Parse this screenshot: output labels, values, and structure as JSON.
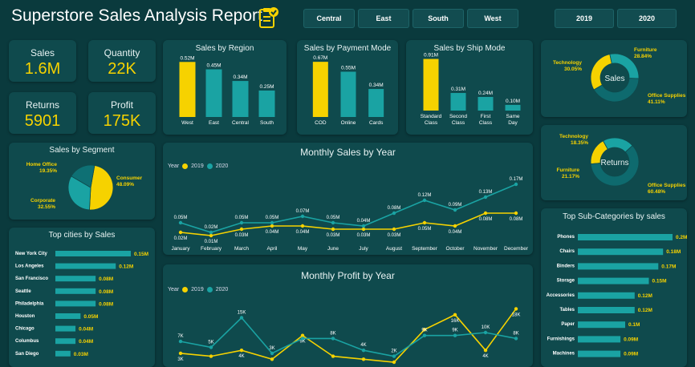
{
  "header": {
    "title": "Superstore Sales Analysis Report",
    "regions": [
      "Central",
      "East",
      "South",
      "West"
    ],
    "years": [
      "2019",
      "2020"
    ]
  },
  "colors": {
    "yellow": "#f6d200",
    "teal": "#1aa3a3",
    "bg": "#0a3a3d",
    "card": "#0f4a4d"
  },
  "kpis": {
    "sales": {
      "label": "Sales",
      "value": "1.6M"
    },
    "quantity": {
      "label": "Quantity",
      "value": "22K"
    },
    "returns": {
      "label": "Returns",
      "value": "5901"
    },
    "profit": {
      "label": "Profit",
      "value": "175K"
    }
  },
  "chart_data": [
    {
      "id": "region",
      "type": "bar",
      "title": "Sales by Region",
      "categories": [
        "West",
        "East",
        "Central",
        "South"
      ],
      "values": [
        0.52,
        0.45,
        0.34,
        0.25
      ],
      "labels": [
        "0.52M",
        "0.45M",
        "0.34M",
        "0.25M"
      ],
      "colors": [
        "#f6d200",
        "#1aa3a3",
        "#1aa3a3",
        "#1aa3a3"
      ]
    },
    {
      "id": "payment",
      "type": "bar",
      "title": "Sales by Payment Mode",
      "categories": [
        "COD",
        "Online",
        "Cards"
      ],
      "values": [
        0.67,
        0.55,
        0.34
      ],
      "labels": [
        "0.67M",
        "0.55M",
        "0.34M"
      ],
      "colors": [
        "#f6d200",
        "#1aa3a3",
        "#1aa3a3"
      ]
    },
    {
      "id": "ship",
      "type": "bar",
      "title": "Sales by Ship Mode",
      "categories": [
        "Standard\nClass",
        "Second\nClass",
        "First\nClass",
        "Same\nDay"
      ],
      "values": [
        0.91,
        0.31,
        0.24,
        0.1
      ],
      "labels": [
        "0.91M",
        "0.31M",
        "0.24M",
        "0.10M"
      ],
      "colors": [
        "#f6d200",
        "#1aa3a3",
        "#1aa3a3",
        "#1aa3a3"
      ]
    },
    {
      "id": "segment",
      "type": "pie",
      "title": "Sales by Segment",
      "categories": [
        "Consumer",
        "Corporate",
        "Home Office"
      ],
      "values": [
        48.09,
        32.55,
        19.35
      ],
      "labels": [
        "48.09%",
        "32.55%",
        "19.35%"
      ],
      "colors": [
        "#f6d200",
        "#1aa3a3",
        "#0e7074"
      ]
    },
    {
      "id": "monthly_sales",
      "type": "line",
      "title": "Monthly Sales by Year",
      "categories": [
        "January",
        "February",
        "March",
        "April",
        "May",
        "June",
        "July",
        "August",
        "September",
        "October",
        "November",
        "December"
      ],
      "series": [
        {
          "name": "2019",
          "color": "#f6d200",
          "values": [
            0.02,
            0.01,
            0.03,
            0.04,
            0.04,
            0.03,
            0.03,
            0.03,
            0.05,
            0.04,
            0.08,
            0.08
          ],
          "labels": [
            "0.02M",
            "0.01M",
            "0.03M",
            "0.04M",
            "0.04M",
            "0.03M",
            "0.03M",
            "0.03M",
            "0.05M",
            "0.04M",
            "0.08M",
            "0.08M"
          ]
        },
        {
          "name": "2020",
          "color": "#1aa3a3",
          "values": [
            0.05,
            0.02,
            0.05,
            0.05,
            0.07,
            0.05,
            0.04,
            0.08,
            0.12,
            0.09,
            0.13,
            0.17
          ],
          "labels": [
            "0.05M",
            "0.02M",
            "0.05M",
            "0.05M",
            "0.07M",
            "0.05M",
            "0.04M",
            "0.08M",
            "0.12M",
            "0.09M",
            "0.13M",
            "0.17M"
          ]
        }
      ],
      "legend_title": "Year",
      "ylim": [
        0,
        0.2
      ]
    },
    {
      "id": "monthly_profit",
      "type": "line",
      "title": "Monthly Profit by Year",
      "categories": [
        "January",
        "February",
        "March",
        "April",
        "May",
        "June",
        "July",
        "August",
        "September",
        "October",
        "November",
        "December"
      ],
      "series": [
        {
          "name": "2019",
          "color": "#f6d200",
          "values": [
            3,
            2,
            4,
            1,
            9,
            2,
            1,
            0,
            11,
            16,
            4,
            18
          ],
          "labels": [
            "3K",
            "",
            "4K",
            "",
            "9K",
            "",
            "",
            "",
            "",
            "16K",
            "4K",
            "18K"
          ]
        },
        {
          "name": "2020",
          "color": "#1aa3a3",
          "values": [
            7,
            5,
            15,
            3,
            8,
            8,
            4,
            2,
            9,
            9,
            10,
            8
          ],
          "labels": [
            "7K",
            "5K",
            "15K",
            "3K",
            "",
            "8K",
            "4K",
            "2K",
            "9K",
            "9K",
            "10K",
            "8K"
          ]
        }
      ],
      "legend_title": "Year",
      "ylim": [
        0,
        20
      ]
    },
    {
      "id": "cities",
      "type": "bar",
      "title": "Top cities by Sales",
      "categories": [
        "New York City",
        "Los Angeles",
        "San Francisco",
        "Seattle",
        "Philadelphia",
        "Houston",
        "Chicago",
        "Columbus",
        "San Diego"
      ],
      "values": [
        0.15,
        0.12,
        0.08,
        0.08,
        0.08,
        0.05,
        0.04,
        0.04,
        0.03
      ],
      "labels": [
        "0.15M",
        "0.12M",
        "0.08M",
        "0.08M",
        "0.08M",
        "0.05M",
        "0.04M",
        "0.04M",
        "0.03M"
      ]
    },
    {
      "id": "subcats",
      "type": "bar",
      "title": "Top Sub-Categories by sales",
      "categories": [
        "Phones",
        "Chairs",
        "Binders",
        "Storage",
        "Accessories",
        "Tables",
        "Paper",
        "Furnishings",
        "Machines"
      ],
      "values": [
        0.2,
        0.18,
        0.17,
        0.15,
        0.12,
        0.12,
        0.1,
        0.09,
        0.09
      ],
      "labels": [
        "0.2M",
        "0.18M",
        "0.17M",
        "0.15M",
        "0.12M",
        "0.12M",
        "0.1M",
        "0.09M",
        "0.09M"
      ]
    },
    {
      "id": "cat_sales",
      "type": "pie",
      "title": "Sales",
      "categories": [
        "Technology",
        "Furniture",
        "Office Supplies"
      ],
      "values": [
        30.05,
        28.84,
        41.11
      ],
      "labels": [
        "30.05%",
        "28.84%",
        "41.11%"
      ],
      "colors": [
        "#f6d200",
        "#1aa3a3",
        "#0e6a6e"
      ]
    },
    {
      "id": "cat_returns",
      "type": "pie",
      "title": "Returns",
      "categories": [
        "Technology",
        "Furniture",
        "Office Supplies"
      ],
      "values": [
        18.35,
        21.17,
        60.48
      ],
      "labels": [
        "18.35%",
        "21.17%",
        "60.48%"
      ],
      "colors": [
        "#f6d200",
        "#1aa3a3",
        "#0e6a6e"
      ]
    }
  ]
}
